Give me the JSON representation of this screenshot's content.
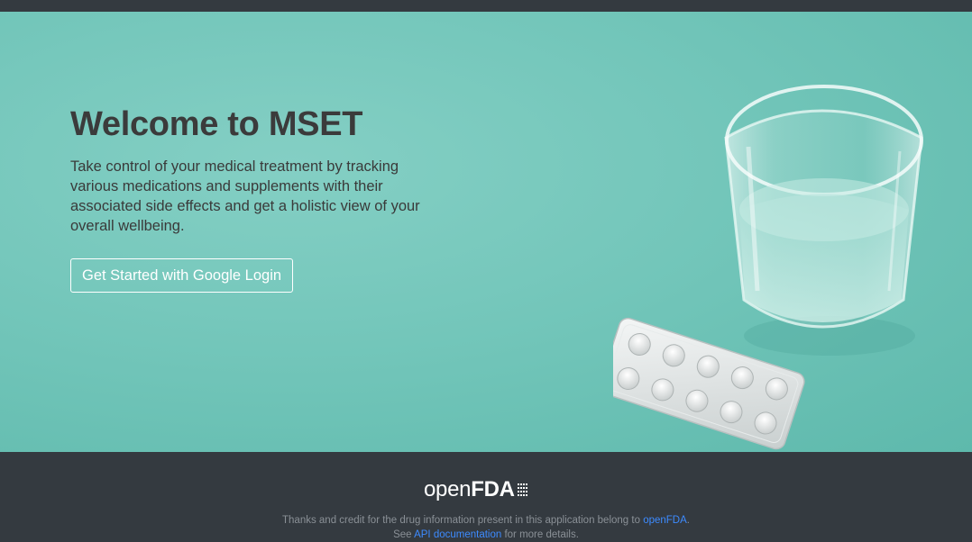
{
  "hero": {
    "title": "Welcome to MSET",
    "description": "Take control of your medical treatment by tracking various medications and supplements with their associated side effects and get a holistic view of your overall wellbeing.",
    "cta_label": "Get Started with Google Login"
  },
  "footer": {
    "logo_open": "open",
    "logo_fda": "FDA",
    "credit_prefix": "Thanks and credit for the drug information present in this application belong to ",
    "credit_link": "openFDA",
    "credit_suffix": ".",
    "see_prefix": "See ",
    "api_link": "API documentation",
    "see_suffix": " for more details."
  },
  "colors": {
    "hero_bg": "#75c7bb",
    "dark": "#343a40",
    "link": "#3d8bff"
  }
}
